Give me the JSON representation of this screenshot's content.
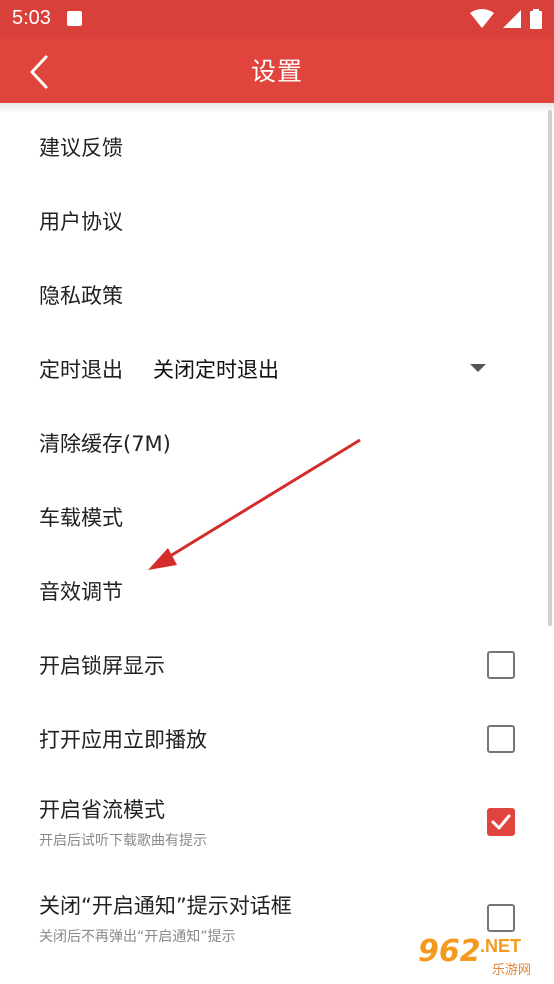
{
  "status": {
    "time": "5:03"
  },
  "header": {
    "title": "设置"
  },
  "items": [
    {
      "label": "建议反馈"
    },
    {
      "label": "用户协议"
    },
    {
      "label": "隐私政策"
    },
    {
      "label": "定时退出",
      "value": "关闭定时退出"
    },
    {
      "label": "清除缓存(7M)"
    },
    {
      "label": "车载模式"
    },
    {
      "label": "音效调节"
    },
    {
      "label": "开启锁屏显示",
      "checked": false
    },
    {
      "label": "打开应用立即播放",
      "checked": false
    },
    {
      "label": "开启省流模式",
      "sub": "开启后试听下载歌曲有提示",
      "checked": true
    },
    {
      "label": "关闭“开启通知”提示对话框",
      "sub": "关闭后不再弹出“开启通知”提示",
      "checked": false
    }
  ],
  "watermark": {
    "big": "962",
    "net": ".NET",
    "small": "乐游网"
  },
  "colors": {
    "accent": "#e0443d",
    "annotation_arrow": "#d42b2b"
  }
}
